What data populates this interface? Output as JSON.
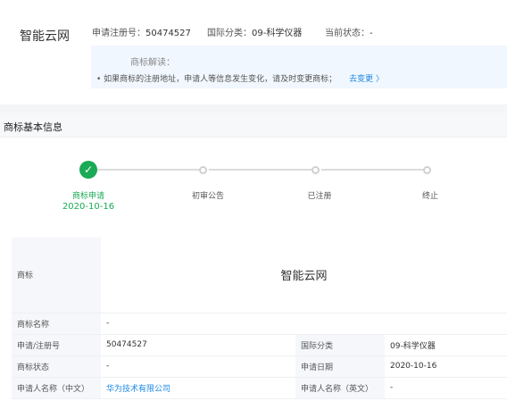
{
  "header": {
    "name": "智能云网",
    "reg_no_label": "申请注册号：",
    "reg_no": "50474527",
    "class_label": "国际分类：",
    "class_value": "09-科学仪器",
    "status_label": "当前状态：",
    "status_value": "-"
  },
  "tip": {
    "title": "商标解读：",
    "text": "• 如果商标的注册地址，申请人等信息发生变化，请及时变更商标；",
    "link": "去变更 〉"
  },
  "section": {
    "title": "商标基本信息"
  },
  "steps": [
    {
      "label": "商标申请",
      "date": "2020-10-16",
      "done": true
    },
    {
      "label": "初审公告",
      "date": "",
      "done": false
    },
    {
      "label": "已注册",
      "date": "",
      "done": false
    },
    {
      "label": "终止",
      "date": "",
      "done": false
    }
  ],
  "colors": {
    "accent_green": "#1aaa55",
    "link_blue": "#1e88e5",
    "tip_bg": "#f0f7fe"
  },
  "table": {
    "trademark_label": "商标",
    "trademark_value": "智能云网",
    "tm_name_label": "商标名称",
    "tm_name_value": "-",
    "app_no_label": "申请/注册号",
    "app_no_value": "50474527",
    "intl_class_label": "国际分类",
    "intl_class_value": "09-科学仪器",
    "tm_status_label": "商标状态",
    "tm_status_value": "-",
    "app_date_label": "申请日期",
    "app_date_value": "2020-10-16",
    "applicant_cn_label": "申请人名称（中文）",
    "applicant_cn_value": "华为技术有限公司",
    "applicant_en_label": "申请人名称（英文）",
    "applicant_en_value": "-"
  }
}
